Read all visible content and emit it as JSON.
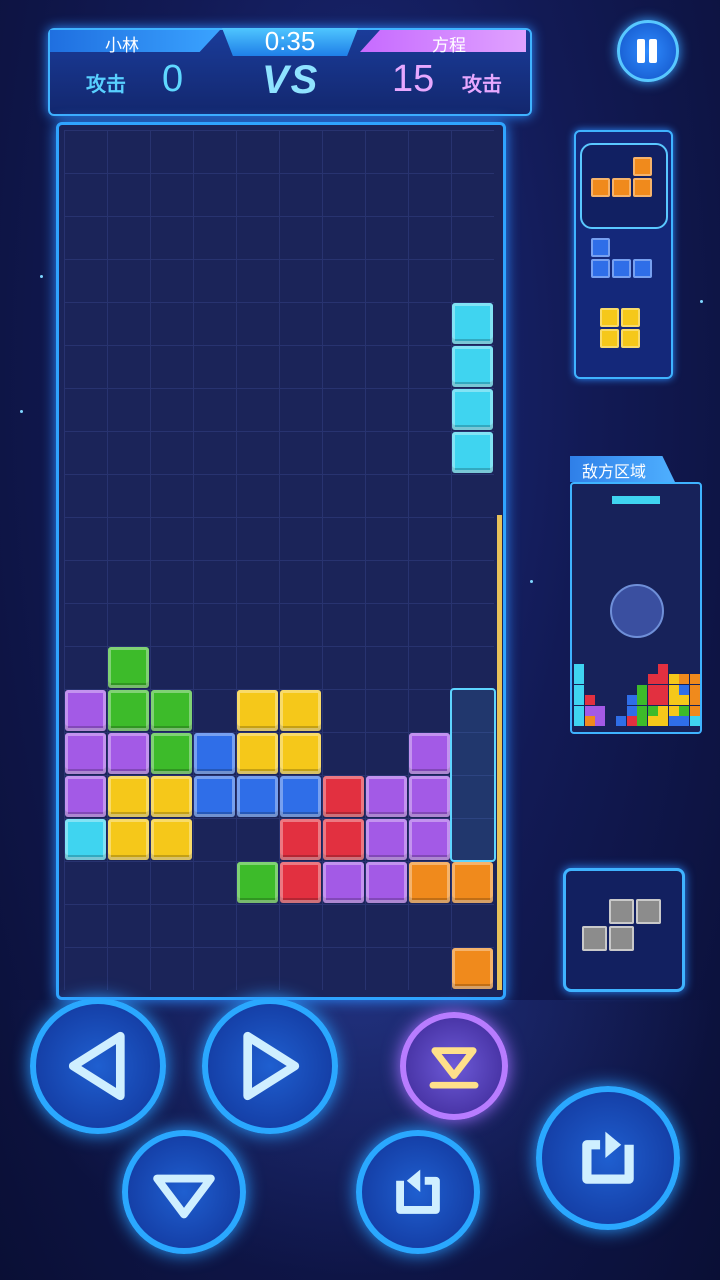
{
  "header": {
    "player1_name": "小林",
    "player2_name": "方程",
    "timer": "0:35",
    "player1_attack_label": "攻击",
    "player2_attack_label": "攻击",
    "player1_score": "0",
    "player2_score": "15",
    "vs_label": "VS"
  },
  "enemy": {
    "label": "敌方区域"
  },
  "colors": {
    "purple": "#a35ae6",
    "green": "#3dbb2a",
    "yellow": "#f5c81a",
    "blue": "#2f6ee8",
    "red": "#e23040",
    "cyan": "#3fd4f0",
    "orange": "#f08a1c"
  },
  "board": {
    "columns": 10,
    "rows": 20,
    "falling_piece": {
      "color": "cyan",
      "cells": [
        [
          9,
          4
        ],
        [
          9,
          5
        ],
        [
          9,
          6
        ],
        [
          9,
          7
        ]
      ]
    },
    "locked": [
      [
        "green",
        1,
        12
      ],
      [
        "purple",
        0,
        13
      ],
      [
        "green",
        1,
        13
      ],
      [
        "green",
        2,
        13
      ],
      [
        "yellow",
        4,
        13
      ],
      [
        "yellow",
        5,
        13
      ],
      [
        "purple",
        0,
        14
      ],
      [
        "purple",
        1,
        14
      ],
      [
        "green",
        2,
        14
      ],
      [
        "blue",
        3,
        14
      ],
      [
        "yellow",
        4,
        14
      ],
      [
        "yellow",
        5,
        14
      ],
      [
        "purple",
        8,
        14
      ],
      [
        "purple",
        0,
        15
      ],
      [
        "yellow",
        1,
        15
      ],
      [
        "yellow",
        2,
        15
      ],
      [
        "blue",
        3,
        15
      ],
      [
        "blue",
        4,
        15
      ],
      [
        "blue",
        5,
        15
      ],
      [
        "red",
        6,
        15
      ],
      [
        "purple",
        7,
        15
      ],
      [
        "purple",
        8,
        15
      ],
      [
        "cyan",
        0,
        16
      ],
      [
        "yellow",
        1,
        16
      ],
      [
        "yellow",
        2,
        16
      ],
      [
        "red",
        5,
        16
      ],
      [
        "red",
        6,
        16
      ],
      [
        "purple",
        7,
        16
      ],
      [
        "purple",
        8,
        16
      ],
      [
        "green",
        4,
        17
      ],
      [
        "red",
        5,
        17
      ],
      [
        "purple",
        6,
        17
      ],
      [
        "purple",
        7,
        17
      ],
      [
        "orange",
        8,
        17
      ],
      [
        "orange",
        9,
        17
      ],
      [
        "orange",
        9,
        19
      ]
    ]
  },
  "next_pieces": [
    {
      "color": "orange",
      "cells": [
        [
          2,
          0
        ],
        [
          0,
          1
        ],
        [
          1,
          1
        ],
        [
          2,
          1
        ]
      ]
    },
    {
      "color": "blue",
      "cells": [
        [
          0,
          0
        ],
        [
          0,
          1
        ],
        [
          1,
          1
        ],
        [
          2,
          1
        ]
      ]
    },
    {
      "color": "yellow",
      "cells": [
        [
          0,
          0
        ],
        [
          1,
          0
        ],
        [
          0,
          1
        ],
        [
          1,
          1
        ]
      ]
    }
  ],
  "hold_piece": {
    "color": "gray",
    "cells": [
      [
        1,
        0
      ],
      [
        2,
        0
      ],
      [
        0,
        1
      ],
      [
        1,
        1
      ]
    ]
  },
  "controls": {
    "left": "move-left",
    "right": "move-right",
    "hard_drop": "hard-drop",
    "soft_drop": "soft-drop",
    "rotate_ccw": "rotate-counterclockwise",
    "rotate_cw": "rotate-clockwise"
  }
}
